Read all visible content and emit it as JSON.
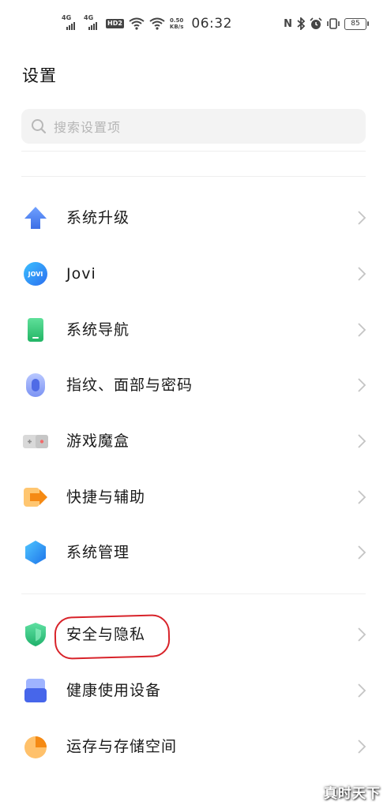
{
  "status_bar": {
    "network_1": "4G",
    "network_2": "4G",
    "hd_badge": "HD2",
    "speed_value": "0.50",
    "speed_unit": "KB/s",
    "time": "06:32",
    "nfc": "N",
    "battery_level": "85"
  },
  "header": {
    "title": "设置"
  },
  "search": {
    "placeholder": "搜索设置项"
  },
  "items": [
    {
      "label": "系统升级",
      "icon": "upgrade-arrow-icon"
    },
    {
      "label": "Jovi",
      "icon": "jovi-icon",
      "icon_text": "JOVI"
    },
    {
      "label": "系统导航",
      "icon": "phone-navigation-icon"
    },
    {
      "label": "指纹、面部与密码",
      "icon": "fingerprint-icon"
    },
    {
      "label": "游戏魔盒",
      "icon": "game-box-icon"
    },
    {
      "label": "快捷与辅助",
      "icon": "shortcut-arrow-icon"
    },
    {
      "label": "系统管理",
      "icon": "system-hexagon-icon"
    },
    {
      "label": "安全与隐私",
      "icon": "shield-icon"
    },
    {
      "label": "健康使用设备",
      "icon": "healthy-use-icon"
    },
    {
      "label": "运存与存储空间",
      "icon": "storage-pie-icon"
    }
  ],
  "watermark": "真时天下",
  "colors": {
    "accent_blue": "#4a7ef0",
    "green": "#2fc47a",
    "orange": "#f59a23",
    "highlight_red": "#d8232a"
  }
}
